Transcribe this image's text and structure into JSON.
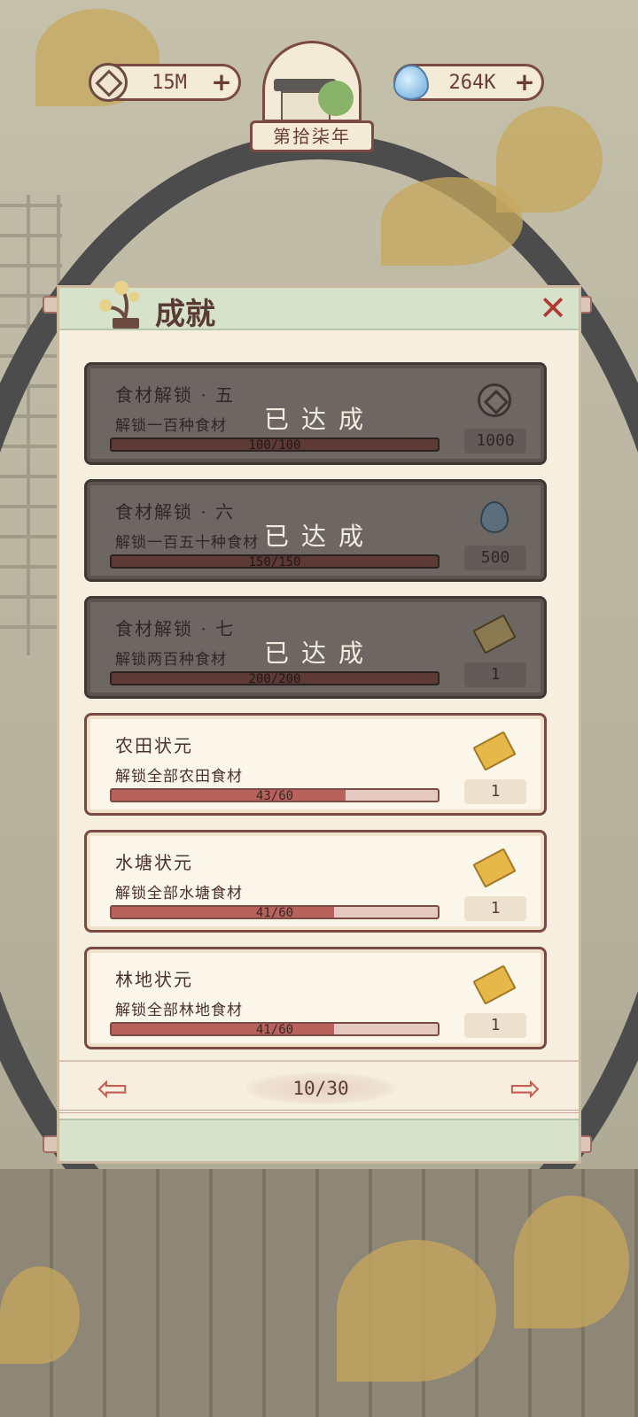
{
  "topbar": {
    "coins": {
      "value": "15M",
      "icon": "coin-icon",
      "plus": "+"
    },
    "water": {
      "value": "264K",
      "icon": "water-drop-icon",
      "plus": "+"
    },
    "year_label": "第拾柒年"
  },
  "panel": {
    "title": "成就",
    "close": "✕",
    "done_label": "已达成",
    "achievements": [
      {
        "name": "食材解锁 · 五",
        "desc": "解锁一百种食材",
        "progress_text": "100/100",
        "progress": 1.0,
        "done": true,
        "reward_icon": "coin-icon",
        "reward": "1000"
      },
      {
        "name": "食材解锁 · 六",
        "desc": "解锁一百五十种食材",
        "progress_text": "150/150",
        "progress": 1.0,
        "done": true,
        "reward_icon": "water-drop-icon",
        "reward": "500"
      },
      {
        "name": "食材解锁 · 七",
        "desc": "解锁两百种食材",
        "progress_text": "200/200",
        "progress": 1.0,
        "done": true,
        "reward_icon": "ticket-icon",
        "reward": "1"
      },
      {
        "name": "农田状元",
        "desc": "解锁全部农田食材",
        "progress_text": "43/60",
        "progress": 0.717,
        "done": false,
        "reward_icon": "ticket-icon",
        "reward": "1"
      },
      {
        "name": "水塘状元",
        "desc": "解锁全部水塘食材",
        "progress_text": "41/60",
        "progress": 0.683,
        "done": false,
        "reward_icon": "ticket-icon",
        "reward": "1"
      },
      {
        "name": "林地状元",
        "desc": "解锁全部林地食材",
        "progress_text": "41/60",
        "progress": 0.683,
        "done": false,
        "reward_icon": "ticket-icon",
        "reward": "1"
      }
    ],
    "pager": {
      "prev": "⇦",
      "next": "⇨",
      "page": "10/30"
    }
  },
  "colors": {
    "accent": "#b7625c",
    "border": "#7b4a44",
    "parchment": "#f6efdf",
    "header_green": "#d6e2c9",
    "completed_card": "#6d6763"
  }
}
